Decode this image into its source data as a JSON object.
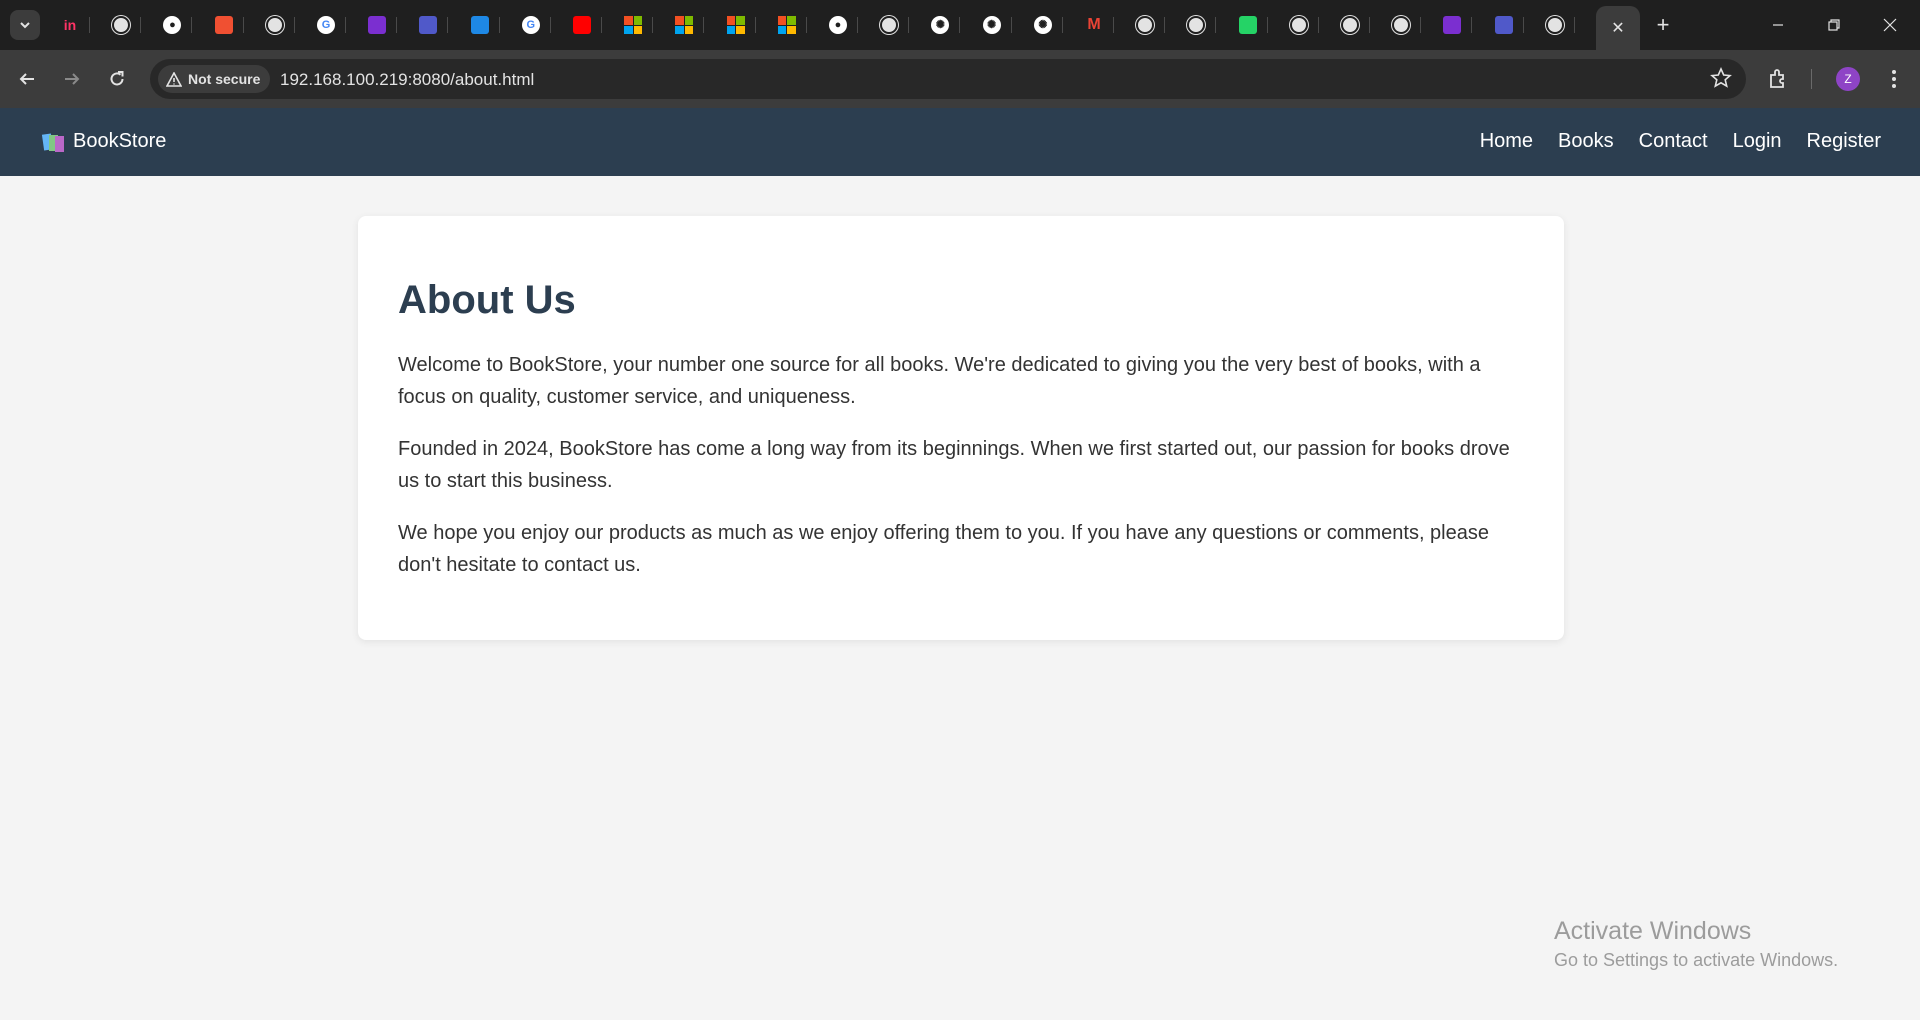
{
  "browser": {
    "tabs": [
      {
        "icon": "tab-search-icon"
      },
      {
        "icon": "invision-icon",
        "glyph": "in",
        "color": "#ff3366"
      },
      {
        "icon": "globe-icon"
      },
      {
        "icon": "github-icon"
      },
      {
        "icon": "git-icon",
        "color": "#f05032"
      },
      {
        "icon": "globe-icon"
      },
      {
        "icon": "google-icon"
      },
      {
        "icon": "forms-icon",
        "color": "#7b2fd0"
      },
      {
        "icon": "teams-icon",
        "color": "#5059c9"
      },
      {
        "icon": "translator-icon",
        "color": "#1e88e5"
      },
      {
        "icon": "google-icon"
      },
      {
        "icon": "youtube-icon",
        "color": "#ff0000"
      },
      {
        "icon": "microsoft-icon"
      },
      {
        "icon": "microsoft-icon"
      },
      {
        "icon": "microsoft-icon"
      },
      {
        "icon": "microsoft-icon"
      },
      {
        "icon": "github-icon"
      },
      {
        "icon": "globe-icon"
      },
      {
        "icon": "chatgpt-icon"
      },
      {
        "icon": "chatgpt-icon"
      },
      {
        "icon": "chatgpt-icon"
      },
      {
        "icon": "gmail-icon"
      },
      {
        "icon": "globe-icon"
      },
      {
        "icon": "globe-icon"
      },
      {
        "icon": "whatsapp-icon",
        "color": "#25d366"
      },
      {
        "icon": "globe-icon"
      },
      {
        "icon": "globe-icon"
      },
      {
        "icon": "globe-icon"
      },
      {
        "icon": "forms-icon",
        "color": "#7b2fd0"
      },
      {
        "icon": "teams-icon",
        "color": "#5059c9"
      },
      {
        "icon": "globe-icon"
      }
    ],
    "active_tab_close": "✕",
    "new_tab": "+",
    "security_label": "Not secure",
    "url": "192.168.100.219:8080/about.html",
    "profile_initial": "Z"
  },
  "site": {
    "brand": "BookStore",
    "nav": [
      "Home",
      "Books",
      "Contact",
      "Login",
      "Register"
    ],
    "colors": {
      "nav_bg": "#2c3e50",
      "heading": "#2c3e50",
      "page_bg": "#f4f4f4"
    }
  },
  "about": {
    "title": "About Us",
    "paragraphs": [
      "Welcome to BookStore, your number one source for all books. We're dedicated to giving you the very best of books, with a focus on quality, customer service, and uniqueness.",
      "Founded in 2024, BookStore has come a long way from its beginnings. When we first started out, our passion for books drove us to start this business.",
      "We hope you enjoy our products as much as we enjoy offering them to you. If you have any questions or comments, please don't hesitate to contact us."
    ]
  },
  "watermark": {
    "title": "Activate Windows",
    "subtitle": "Go to Settings to activate Windows."
  }
}
